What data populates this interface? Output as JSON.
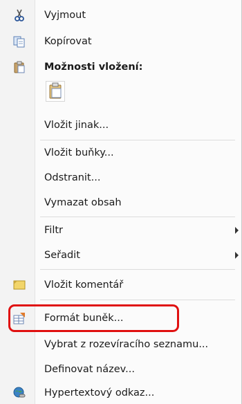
{
  "menu": {
    "items": [
      {
        "label": "Vyjmout",
        "icon": "scissors-icon"
      },
      {
        "label": "Kopírovat",
        "icon": "copy-icon"
      },
      {
        "label": "Možnosti vložení:",
        "icon": "clipboard-icon"
      },
      {
        "label": "Vložit jinak..."
      },
      {
        "label": "Vložit buňky..."
      },
      {
        "label": "Odstranit..."
      },
      {
        "label": "Vymazat obsah"
      },
      {
        "label": "Filtr"
      },
      {
        "label": "Seřadit"
      },
      {
        "label": "Vložit komentář",
        "icon": "comment-icon"
      },
      {
        "label": "Formát buněk...",
        "icon": "format-cells-icon"
      },
      {
        "label": "Vybrat z rozevíracího seznamu..."
      },
      {
        "label": "Definovat název..."
      },
      {
        "label": "Hypertextový odkaz...",
        "icon": "hyperlink-icon"
      }
    ]
  },
  "colors": {
    "highlight": "#e01010"
  }
}
